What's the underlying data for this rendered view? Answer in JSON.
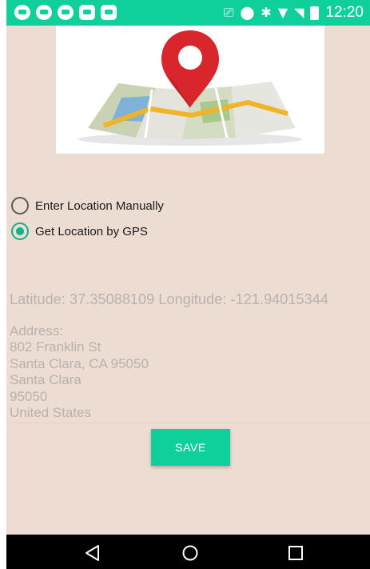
{
  "status_bar": {
    "time": "12:20",
    "notification_icons": [
      "app-notification-icon",
      "app-notification-icon",
      "app-notification-icon",
      "briefcase-icon",
      "briefcase-check-icon"
    ],
    "system_icons": [
      "cast-icon",
      "location-pin-icon",
      "bluetooth-icon",
      "wifi-icon",
      "signal-icon",
      "battery-icon"
    ],
    "glyphs": {
      "cast": "⎚",
      "location": "⬤",
      "bluetooth": "✱",
      "wifi": "▼",
      "signal": "◥"
    }
  },
  "location_mode": {
    "options": [
      {
        "label": "Enter Location Manually",
        "selected": false
      },
      {
        "label": "Get Location by GPS",
        "selected": true
      }
    ]
  },
  "location": {
    "coords_text": "Latitude: 37.35088109 Longitude: -121.94015344",
    "address_lines": [
      "Address:",
      "802 Franklin St",
      "Santa Clara, CA 95050",
      "Santa Clara",
      "95050",
      "United States"
    ]
  },
  "actions": {
    "save_label": "SAVE"
  },
  "colors": {
    "accent": "#0fd09b",
    "background": "#eddcd2",
    "muted_text": "#b9b2ad",
    "pin": "#d8262c"
  },
  "nav_bar": {
    "buttons": [
      "back-icon",
      "home-icon",
      "recents-icon"
    ]
  }
}
